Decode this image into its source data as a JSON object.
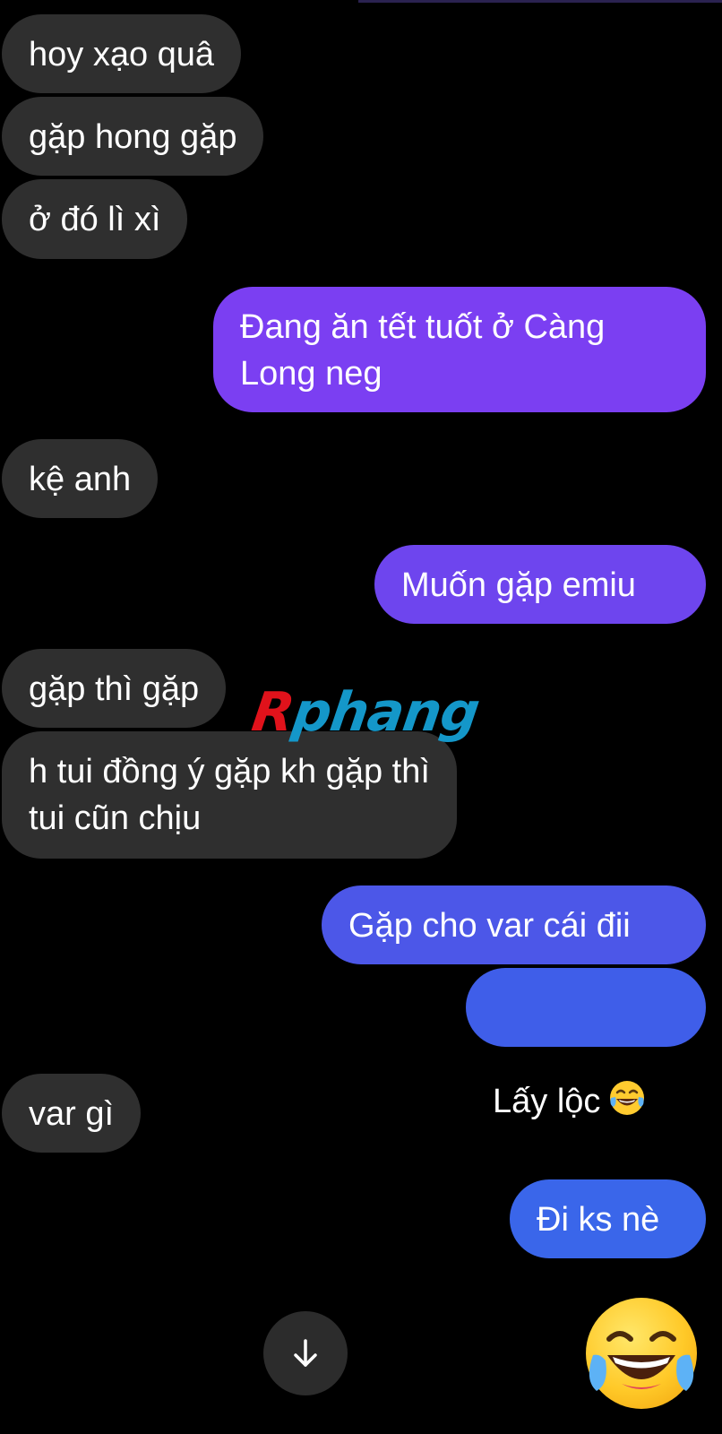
{
  "messages": [
    {
      "side": "in",
      "text": "hoy xạo quâ"
    },
    {
      "side": "in",
      "text": "gặp hong gặp"
    },
    {
      "side": "in",
      "text": "ở đó lì xì"
    },
    {
      "side": "out",
      "text": "Đang ăn tết tuốt ở Càng\nLong neg",
      "color": "#7b3ff2"
    },
    {
      "side": "in",
      "text": "kệ anh"
    },
    {
      "side": "out",
      "text": "Muốn gặp emiu",
      "color": "#6e45ee"
    },
    {
      "side": "in",
      "text": "gặp thì gặp"
    },
    {
      "side": "in",
      "text": "h tui đồng ý gặp kh gặp thì\ntui cũn chịu"
    },
    {
      "side": "out",
      "text": "Gặp cho var cái đii",
      "color": "#4c57e8"
    },
    {
      "side": "out",
      "text": "Lấy lộc",
      "emoji": "face-with-tears-of-joy-icon",
      "color": "#3f5ee9"
    },
    {
      "side": "in",
      "text": "var gì"
    },
    {
      "side": "out",
      "text": "Đi ks nè",
      "color": "#3a66ea"
    }
  ],
  "watermark": {
    "first": "R",
    "rest": "phang"
  },
  "scroll_button_icon": "arrow-down-icon",
  "reaction_icon": "face-with-tears-of-joy-icon",
  "colors": {
    "background": "#000000",
    "incoming_bubble": "#2f2f2f"
  }
}
